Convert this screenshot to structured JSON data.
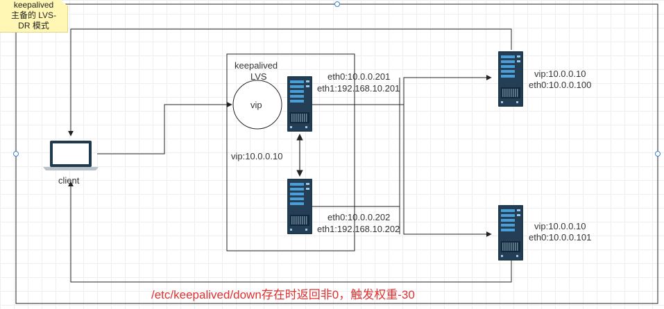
{
  "note": {
    "lines": [
      "keepalived",
      "主备的 LVS-",
      "DR 模式"
    ]
  },
  "client": {
    "label": "client"
  },
  "lvs_group": {
    "title_line1": "keepalived",
    "title_line2": "LVS",
    "vip_circle": "vip",
    "vip_text": "vip:10.0.0.10"
  },
  "director_master": {
    "eth0": "eth0:10.0.0.201",
    "eth1": "eth1:192.168.10.201"
  },
  "director_backup": {
    "eth0": "eth0:10.0.0.202",
    "eth1": "eth1:192.168.10.202"
  },
  "real_server_1": {
    "vip": "vip:10.0.0.10",
    "eth0": "eth0:10.0.0.100"
  },
  "real_server_2": {
    "vip": "vip:10.0.0.10",
    "eth0": "eth0:10.0.0.101"
  },
  "caption": "/etc/keepalived/down存在时返回非0，触发权重-30",
  "colors": {
    "caption": "#e03030",
    "server_body": "#1f3a4d",
    "server_accent": "#4a9fd6",
    "note_bg": "#fff7b3",
    "selection_handle": "#3d7fd0"
  }
}
